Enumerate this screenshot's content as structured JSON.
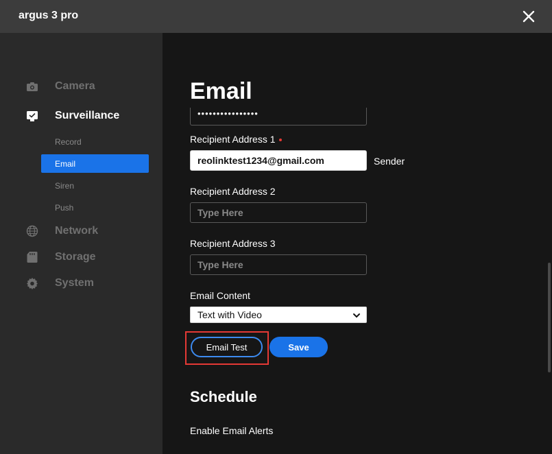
{
  "window": {
    "title": "argus 3 pro"
  },
  "sidebar": {
    "items": [
      {
        "label": "Camera",
        "icon": "camera-icon"
      },
      {
        "label": "Surveillance",
        "icon": "monitor-icon",
        "active": true
      },
      {
        "label": "Network",
        "icon": "globe-icon"
      },
      {
        "label": "Storage",
        "icon": "sd-card-icon"
      },
      {
        "label": "System",
        "icon": "gear-icon"
      }
    ],
    "subitems": [
      {
        "label": "Record"
      },
      {
        "label": "Email",
        "active": true
      },
      {
        "label": "Siren"
      },
      {
        "label": "Push"
      }
    ]
  },
  "main": {
    "title": "Email",
    "password_mask": "••••••••••••••••",
    "recipient1": {
      "label": "Recipient Address 1",
      "value": "reolinktest1234@gmail.com",
      "tag": "Sender"
    },
    "recipient2": {
      "label": "Recipient Address 2",
      "placeholder": "Type Here"
    },
    "recipient3": {
      "label": "Recipient Address 3",
      "placeholder": "Type Here"
    },
    "content": {
      "label": "Email Content",
      "selected": "Text with Video"
    },
    "buttons": {
      "test": "Email Test",
      "save": "Save"
    },
    "schedule": {
      "title": "Schedule",
      "enable_label": "Enable Email Alerts"
    }
  },
  "colors": {
    "accent": "#1a73e8",
    "highlight": "#e53935",
    "titlebar": "#3c3c3c",
    "sidebar": "#2a2a2a",
    "content": "#161616"
  }
}
